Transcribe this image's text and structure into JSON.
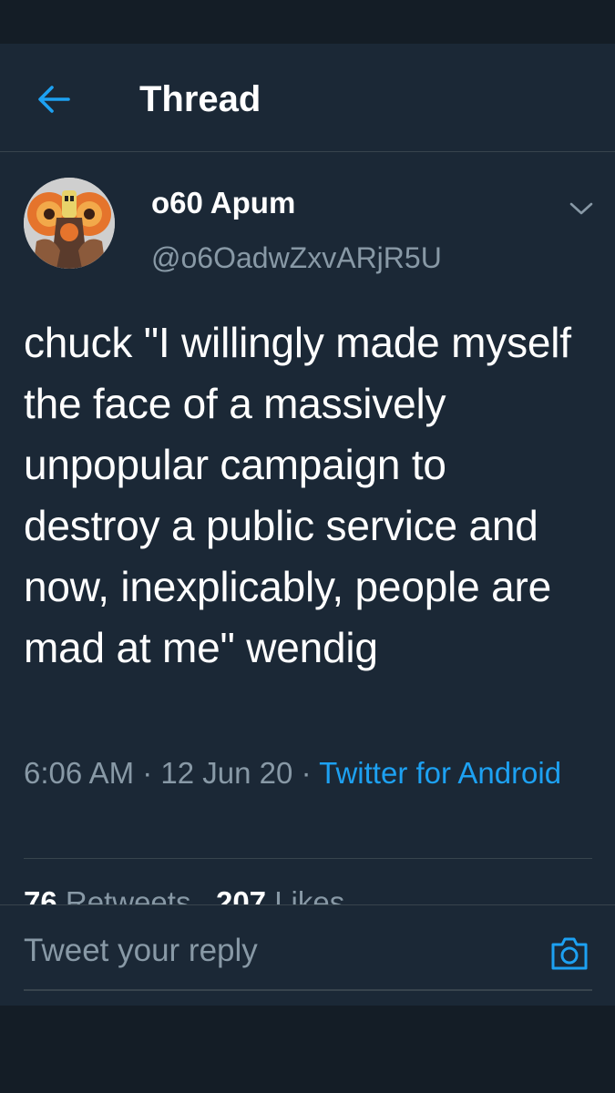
{
  "header": {
    "title": "Thread"
  },
  "tweet": {
    "name": "o60 Apum",
    "handle": "@o6OadwZxvARjR5U",
    "text": "chuck \"I willingly made myself the face of a massively unpopular campaign to destroy a public service and now, inexplicably, people are mad at me\" wendig",
    "time": "6:06 AM",
    "date": "12 Jun 20",
    "separator": "·",
    "source": "Twitter for Android",
    "stats": {
      "retweets_count": "76",
      "retweets_label": "Retweets",
      "likes_count": "207",
      "likes_label": "Likes"
    }
  },
  "reply": {
    "placeholder": "Tweet your reply"
  },
  "colors": {
    "background": "#141d26",
    "surface": "#1b2836",
    "accent": "#1da1f2",
    "muted_text": "#8899a6",
    "divider": "#38444d"
  },
  "icons": {
    "back": "arrow-left-icon",
    "caret": "chevron-down-icon",
    "camera": "camera-icon"
  }
}
